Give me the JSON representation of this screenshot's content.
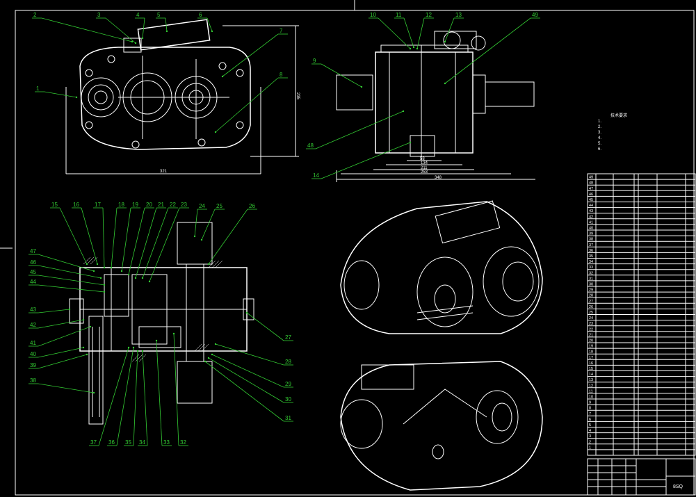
{
  "drawing": {
    "title_block_code": "8SQ",
    "notes_title": "技术要求",
    "notes_items": [
      "1.",
      "2.",
      "3.",
      "4.",
      "5.",
      "6."
    ]
  },
  "dimensions": {
    "front_width": "321",
    "front_height": "235",
    "side_d1": "58",
    "side_d2": "134",
    "side_d3": "211",
    "side_d4": "253",
    "side_d5": "348"
  },
  "callouts": [
    "1",
    "2",
    "3",
    "4",
    "5",
    "6",
    "7",
    "8",
    "9",
    "10",
    "11",
    "12",
    "13",
    "14",
    "15",
    "16",
    "17",
    "18",
    "19",
    "20",
    "21",
    "22",
    "23",
    "24",
    "25",
    "26",
    "27",
    "28",
    "29",
    "30",
    "31",
    "32",
    "33",
    "34",
    "35",
    "36",
    "37",
    "38",
    "39",
    "40",
    "41",
    "42",
    "43",
    "44",
    "45",
    "46",
    "47",
    "48",
    "49"
  ],
  "bom": {
    "row_numbers": [
      "49",
      "48",
      "47",
      "46",
      "45",
      "44",
      "43",
      "42",
      "41",
      "40",
      "39",
      "38",
      "37",
      "36",
      "35",
      "34",
      "33",
      "32",
      "31",
      "30",
      "29",
      "28",
      "27",
      "26",
      "25",
      "24",
      "23",
      "22",
      "21",
      "20",
      "19",
      "18",
      "17",
      "16",
      "15",
      "14",
      "13",
      "12",
      "11",
      "10",
      "9",
      "8",
      "7",
      "6",
      "5",
      "4",
      "3",
      "2",
      "1"
    ]
  },
  "colors": {
    "background": "#000000",
    "lines": "#ffffff",
    "callouts": "#33cc33"
  }
}
